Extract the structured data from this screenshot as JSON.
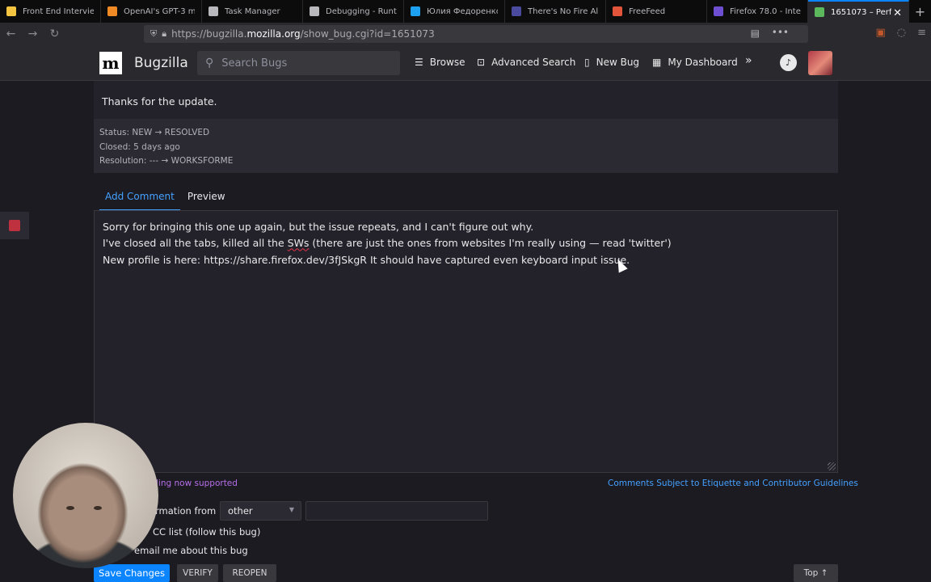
{
  "browser": {
    "tabs": [
      {
        "label": "Front End Intervie",
        "color": "#f5c542"
      },
      {
        "label": "OpenAI's GPT-3 m",
        "color": "#f08a24"
      },
      {
        "label": "Task Manager",
        "color": "#b8b8bd"
      },
      {
        "label": "Debugging - Runt",
        "color": "#b8b8bd"
      },
      {
        "label": "Юлия Федоренко",
        "color": "#1da1f2"
      },
      {
        "label": "There's No Fire Al",
        "color": "#4a4a9e"
      },
      {
        "label": "FreeFeed",
        "color": "#e2553b"
      },
      {
        "label": "Firefox 78.0 - Inte",
        "color": "#6e4fd1"
      },
      {
        "label": "1651073 – Perf",
        "color": "#5cb85c",
        "active": true
      }
    ],
    "url_prefix": "https://bugzilla.",
    "url_host": "mozilla.org",
    "url_suffix": "/show_bug.cgi?id=1651073"
  },
  "header": {
    "brand": "Bugzilla",
    "search_placeholder": "Search Bugs",
    "links": {
      "browse": "Browse",
      "advanced_search": "Advanced Search",
      "new_bug": "New Bug",
      "my_dashboard": "My Dashboard"
    }
  },
  "comment": {
    "text": "Thanks for the update."
  },
  "changes": {
    "status": "Status: NEW → RESOLVED",
    "closed": "Closed: 5 days ago",
    "resolution": "Resolution: --- → WORKSFORME"
  },
  "comment_tabs": {
    "add": "Add Comment",
    "preview": "Preview"
  },
  "editor": {
    "line1": "Sorry for bringing this one up again, but the issue repeats, and I can't figure out why.",
    "line2_pre": "I've closed all the tabs, killed all the ",
    "line2_spell": "SWs",
    "line2_post": " (there are just the ones from websites I'm really using — read 'twitter')",
    "line3": "New profile is here: https://share.firefox.dev/3fJSkgR It should have captured even keyboard input issue."
  },
  "form": {
    "markdown_note": "ling now supported",
    "etiquette_link": "Comments Subject to Etiquette and Contributor Guidelines",
    "needinfo_label": "ormation from",
    "needinfo_selected": "other",
    "cc_label": "CC list (follow this bug)",
    "email_label": "email me about this bug",
    "save": "Save Changes",
    "verify": "VERIFY",
    "reopen": "REOPEN",
    "top": "Top ↑"
  }
}
